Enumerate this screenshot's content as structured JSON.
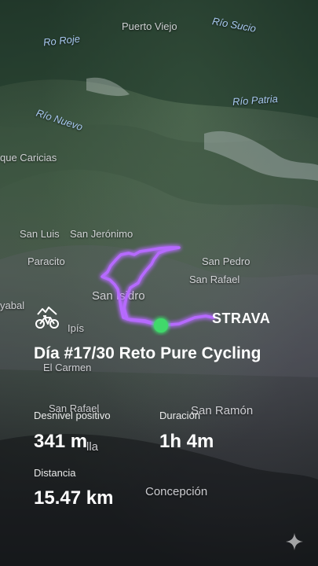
{
  "map": {
    "places": [
      {
        "name": "Puerto Viejo"
      },
      {
        "name": "San Luis"
      },
      {
        "name": "San Jerónimo"
      },
      {
        "name": "Paracito"
      },
      {
        "name": "San Pedro"
      },
      {
        "name": "San Rafael"
      },
      {
        "name": "San Isidro"
      },
      {
        "name": "yabal"
      },
      {
        "name": "Ipís"
      },
      {
        "name": "El Carmen"
      },
      {
        "name": "San Rafael"
      },
      {
        "name": "San Ramón"
      },
      {
        "name": "Concepción"
      },
      {
        "name": "que Caricias"
      },
      {
        "name": "lla"
      }
    ],
    "rivers": [
      {
        "name": "Río Sucio"
      },
      {
        "name": "Río Patria"
      },
      {
        "name": "Río Nuevo"
      },
      {
        "name": "Ro Roje"
      }
    ]
  },
  "brand": {
    "name": "STRAVA"
  },
  "activity": {
    "icon": "mountain-bike-icon",
    "title": "Día #17/30 Reto Pure Cycling",
    "stats": {
      "elevation_label": "Desnivel positivo",
      "elevation_value": "341 m",
      "duration_label": "Duración",
      "duration_value": "1h 4m",
      "distance_label": "Distancia",
      "distance_value": "15.47 km"
    }
  },
  "colors": {
    "route": "#b66bff",
    "route_glow": "#8a2be2",
    "start_marker": "#3fd96b"
  },
  "ui": {
    "sparkle_icon": "sparkle-icon"
  }
}
